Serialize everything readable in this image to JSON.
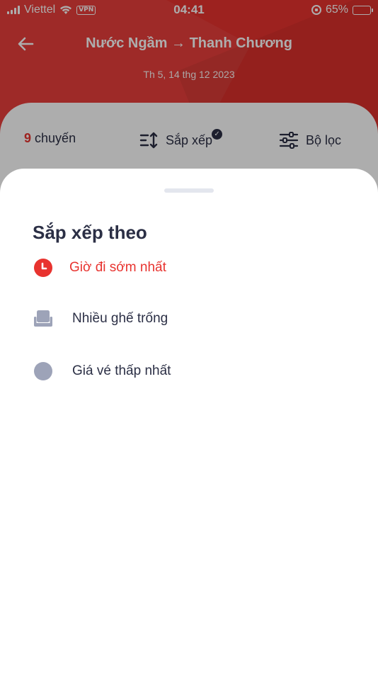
{
  "status_bar": {
    "carrier": "Viettel",
    "vpn": "VPN",
    "time": "04:41",
    "battery": "65%",
    "battery_level": 0.65
  },
  "header": {
    "route": "Nước Ngầm → Thanh Chương",
    "date": "Th 5, 14 thg 12 2023"
  },
  "filter_bar": {
    "trip_count": "9",
    "trip_label": "chuyến",
    "sort_label": "Sắp xếp",
    "filter_label": "Bộ lọc"
  },
  "sort_sheet": {
    "title": "Sắp xếp theo",
    "options": [
      {
        "label": "Giờ đi sớm nhất",
        "icon": "clock-icon",
        "selected": true
      },
      {
        "label": "Nhiều ghế trống",
        "icon": "seat-icon",
        "selected": false
      },
      {
        "label": "Giá vé thấp nhất",
        "icon": "coin-icon",
        "selected": false
      }
    ]
  },
  "colors": {
    "brand_red": "#e8332f",
    "text_dark": "#2b2f45",
    "icon_gray": "#9da3b8"
  }
}
